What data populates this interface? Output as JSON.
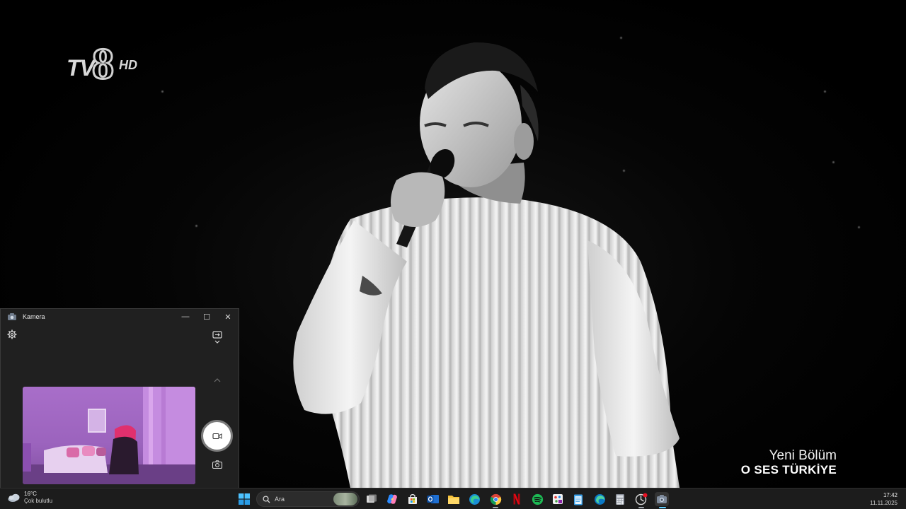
{
  "video": {
    "channel_logo": {
      "text_tv": "TV",
      "text_8": "8",
      "text_hd": "HD"
    },
    "promo": {
      "line1": "Yeni Bölüm",
      "line2": "O SES TÜRKİYE"
    }
  },
  "camera_window": {
    "title": "Kamera",
    "icons": {
      "app": "camera-app-icon",
      "minimize": "minimize-icon",
      "maximize": "maximize-icon",
      "close": "close-icon",
      "settings": "gear-icon",
      "switch_camera": "switch-camera-icon",
      "chevron": "chevron-up-icon",
      "record": "video-record-icon",
      "photo": "photo-camera-icon"
    },
    "glyphs": {
      "minimize": "—",
      "maximize": "☐",
      "close": "✕"
    }
  },
  "taskbar": {
    "weather": {
      "temp": "16°C",
      "condition": "Çok bulutlu",
      "icon": "cloud-icon"
    },
    "search": {
      "placeholder": "Ara",
      "icon": "search-icon"
    },
    "apps": [
      "windows-start-icon",
      "task-view-icon",
      "copilot-icon",
      "microsoft-store-icon",
      "outlook-icon",
      "file-explorer-icon",
      "edge-icon",
      "chrome-icon",
      "netflix-icon",
      "spotify-icon",
      "paint-icon",
      "notepad-icon",
      "edge-browser-icon",
      "calculator-icon",
      "media-app-icon",
      "camera-app-icon"
    ],
    "clock": {
      "time": "17:42",
      "date": "11.11.2025"
    }
  },
  "colors": {
    "taskbar_bg": "#1c1c1c",
    "window_bg": "#202020",
    "preview_tint": "#a86ec9",
    "netflix": "#e50914",
    "spotify": "#1db954"
  }
}
